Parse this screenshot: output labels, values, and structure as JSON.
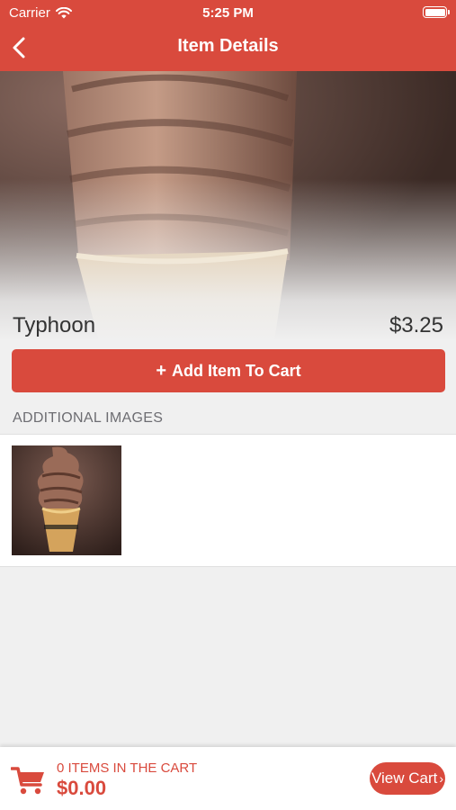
{
  "status_bar": {
    "carrier": "Carrier",
    "time": "5:25 PM",
    "icons": [
      "wifi-icon",
      "battery-icon"
    ]
  },
  "nav": {
    "title": "Item Details",
    "back_icon": "chevron-left-icon"
  },
  "item": {
    "name": "Typhoon",
    "price": "$3.25",
    "hero_image": "chocolate soft-serve ice cream cone"
  },
  "actions": {
    "add_to_cart_icon": "plus-icon",
    "add_to_cart_label": "Add Item To Cart"
  },
  "additional_images": {
    "label": "ADDITIONAL IMAGES",
    "items": [
      {
        "alt": "chocolate soft-serve cone thumbnail"
      }
    ]
  },
  "cart_bar": {
    "icon": "cart-icon",
    "count_text": "0 ITEMS IN THE CART",
    "total": "$0.00",
    "view_cart_label": "View Cart",
    "view_cart_icon": "chevron-right-icon"
  },
  "colors": {
    "brand": "#d94a3d",
    "background": "#f0f0f0",
    "panel": "#ffffff"
  }
}
